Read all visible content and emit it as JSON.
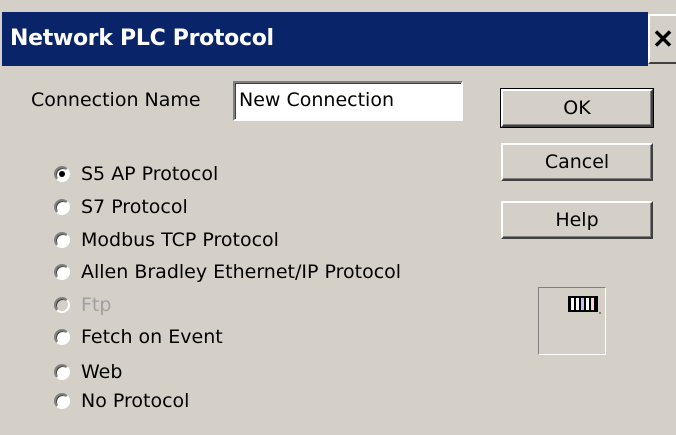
{
  "window": {
    "title": "Network PLC Protocol",
    "close_glyph": "✕",
    "colors": {
      "titlebar": "#0a246a",
      "face": "#d4d0c8"
    }
  },
  "connection": {
    "label": "Connection Name",
    "value": "New Connection"
  },
  "buttons": {
    "ok": "OK",
    "cancel": "Cancel",
    "help": "Help"
  },
  "protocols": [
    {
      "label": "S5 AP Protocol",
      "checked": true,
      "enabled": true
    },
    {
      "label": "S7 Protocol",
      "checked": false,
      "enabled": true
    },
    {
      "label": "Modbus TCP Protocol",
      "checked": false,
      "enabled": true
    },
    {
      "label": "Allen Bradley Ethernet/IP Protocol",
      "checked": false,
      "enabled": true
    },
    {
      "label": "Ftp",
      "checked": false,
      "enabled": false
    },
    {
      "label": "Fetch on Event",
      "checked": false,
      "enabled": true
    },
    {
      "label": "Web",
      "checked": false,
      "enabled": true
    },
    {
      "label": "No Protocol",
      "checked": false,
      "enabled": true
    }
  ],
  "icon": {
    "name": "plc-rack-icon"
  }
}
